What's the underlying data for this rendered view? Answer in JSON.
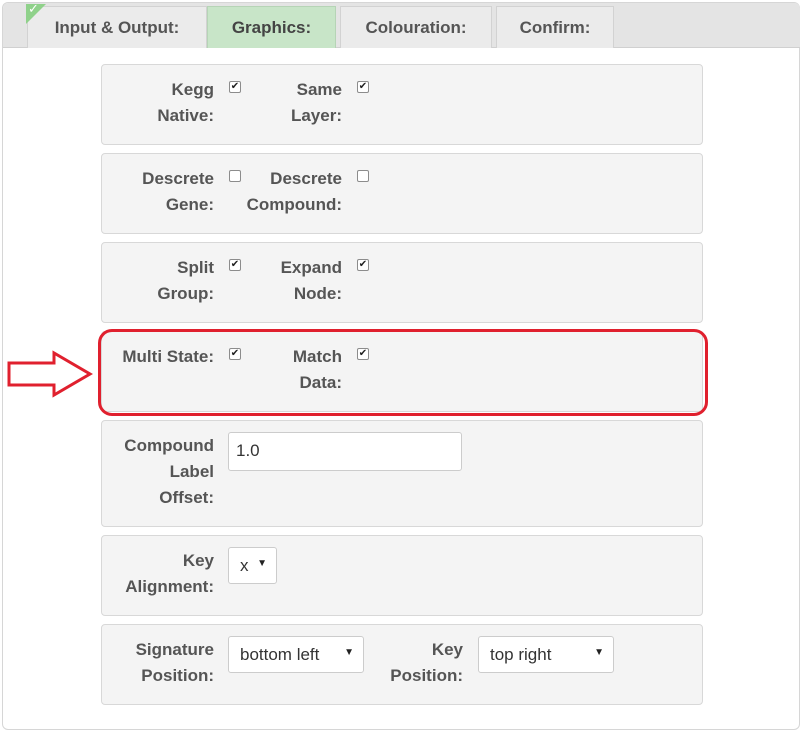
{
  "tabs": [
    {
      "label": "Input & Output:",
      "active": false,
      "completed": true
    },
    {
      "label": "Graphics:",
      "active": true,
      "completed": false
    },
    {
      "label": "Colouration:",
      "active": false,
      "completed": false
    },
    {
      "label": "Confirm:",
      "active": false,
      "completed": false
    }
  ],
  "graphics": {
    "kegg_native": {
      "label1": "Kegg",
      "label2": "Native:",
      "checked": true
    },
    "same_layer": {
      "label1": "Same",
      "label2": "Layer:",
      "checked": true
    },
    "descrete_gene": {
      "label1": "Descrete",
      "label2": "Gene:",
      "checked": false
    },
    "descrete_compound": {
      "label1": "Descrete",
      "label2": "Compound:",
      "checked": false
    },
    "split_group": {
      "label1": "Split",
      "label2": "Group:",
      "checked": true
    },
    "expand_node": {
      "label1": "Expand",
      "label2": "Node:",
      "checked": true
    },
    "multi_state": {
      "label1": "Multi State:",
      "checked": true
    },
    "match_data": {
      "label1": "Match",
      "label2": "Data:",
      "checked": true
    },
    "compound_label_offset": {
      "label1": "Compound",
      "label2": "Label",
      "label3": "Offset:",
      "value": "1.0"
    },
    "key_alignment": {
      "label1": "Key",
      "label2": "Alignment:",
      "value": "x"
    },
    "signature_position": {
      "label1": "Signature",
      "label2": "Position:",
      "value": "bottom left"
    },
    "key_position": {
      "label1": "Key",
      "label2": "Position:",
      "value": "top right"
    }
  },
  "annotation": {
    "color": "#e0202e",
    "icon": "right-arrow-icon"
  }
}
